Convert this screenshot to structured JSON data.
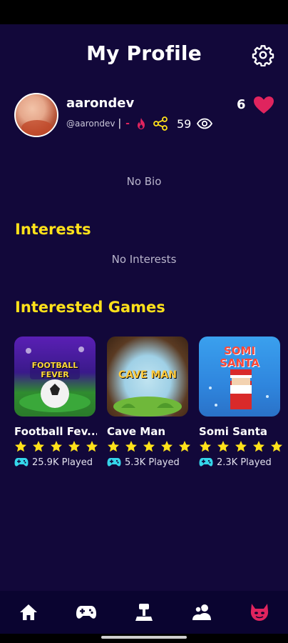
{
  "header": {
    "title": "My Profile",
    "settings_icon": "gear-icon"
  },
  "profile": {
    "username": "aarondev",
    "handle": "@aarondev",
    "separator": "|",
    "dash": "-",
    "views": "59",
    "likes": "6"
  },
  "bio": {
    "text": "No Bio"
  },
  "interests": {
    "title": "Interests",
    "empty_text": "No Interests"
  },
  "interested_games": {
    "title": "Interested Games",
    "games": [
      {
        "name": "Football Fev...",
        "played": "25.9K Played",
        "rating": 5,
        "thumb_text": "FOOTBALL\nFEVER"
      },
      {
        "name": "Cave Man",
        "played": "5.3K Played",
        "rating": 5,
        "thumb_text": "CAVE MAN"
      },
      {
        "name": "Somi Santa",
        "played": "2.3K Played",
        "rating": 5,
        "thumb_text": "SOMI\nSANTA"
      }
    ]
  },
  "bottom_nav": [
    {
      "name": "home",
      "icon": "home-icon"
    },
    {
      "name": "games",
      "icon": "gamepad-icon"
    },
    {
      "name": "leaderboard",
      "icon": "trophy-icon"
    },
    {
      "name": "friends",
      "icon": "users-icon"
    },
    {
      "name": "profile",
      "icon": "devil-icon",
      "active": true
    }
  ],
  "colors": {
    "background": "#12083a",
    "accent_yellow": "#ffe11a",
    "heart": "#e0245e",
    "nav_bg": "#0a0430",
    "controller": "#35d6ea"
  }
}
